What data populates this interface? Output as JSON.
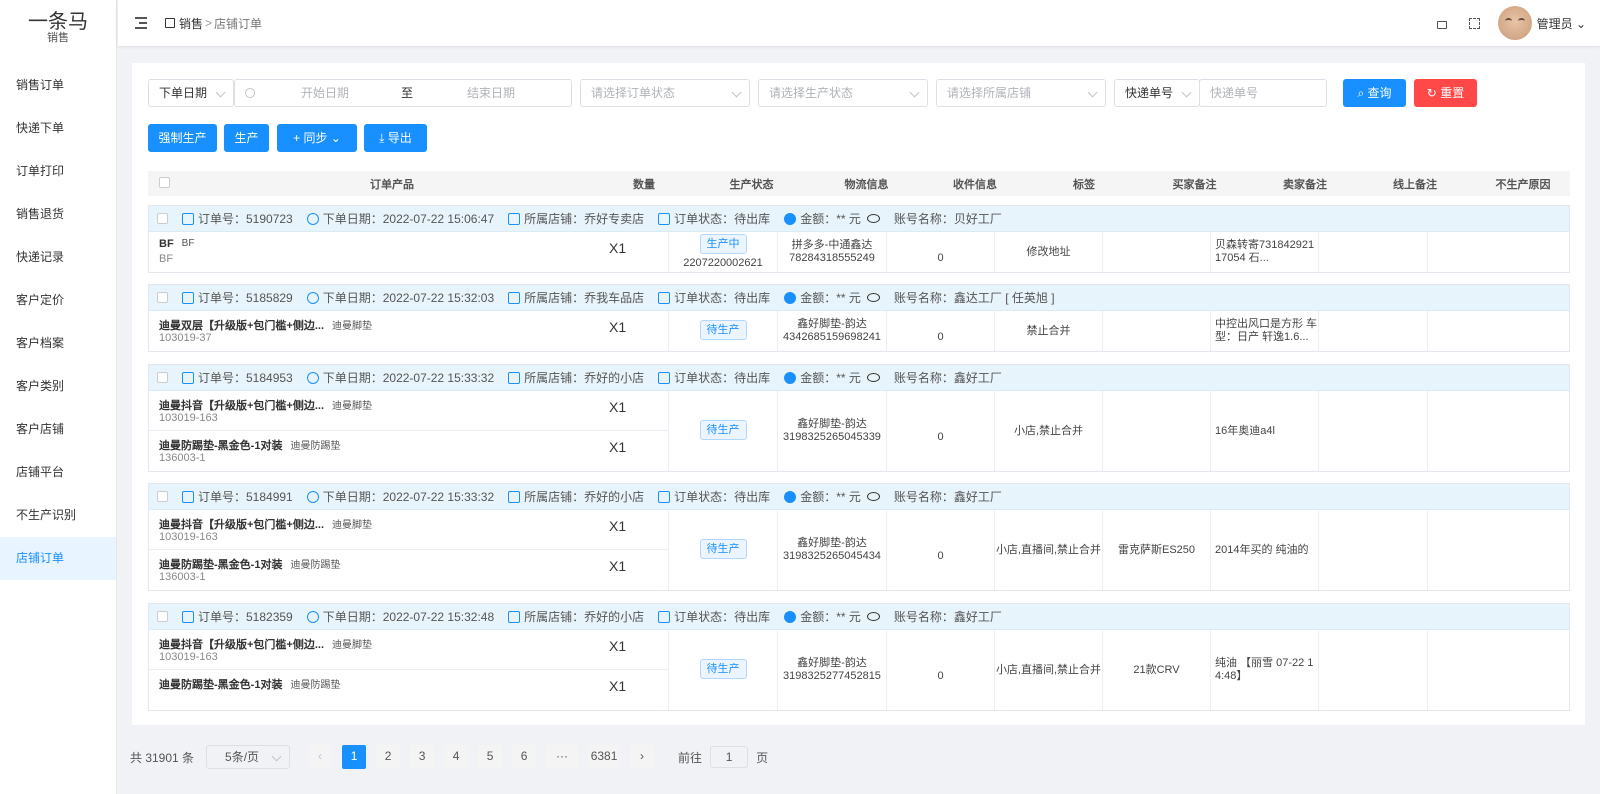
{
  "logo": {
    "title": "一条马",
    "subtitle": "销售"
  },
  "sidebar": {
    "items": [
      {
        "label": "销售订单"
      },
      {
        "label": "快递下单"
      },
      {
        "label": "订单打印"
      },
      {
        "label": "销售退货"
      },
      {
        "label": "快递记录"
      },
      {
        "label": "客户定价"
      },
      {
        "label": "客户档案"
      },
      {
        "label": "客户类别"
      },
      {
        "label": "客户店铺"
      },
      {
        "label": "店铺平台"
      },
      {
        "label": "不生产识别"
      },
      {
        "label": "店铺订单",
        "active": true
      }
    ]
  },
  "header": {
    "breadcrumb": {
      "home": "销售",
      "sep": ">",
      "current": "店铺订单"
    },
    "user": "管理员"
  },
  "filters": {
    "date_type": "下单日期",
    "start_placeholder": "开始日期",
    "range_sep": "至",
    "end_placeholder": "结束日期",
    "order_status_placeholder": "请选择订单状态",
    "production_status_placeholder": "请选择生产状态",
    "store_placeholder": "请选择所属店铺",
    "express_type": "快递单号",
    "express_placeholder": "快递单号",
    "search_label": "查询",
    "reset_label": "重置"
  },
  "actions": {
    "force_produce": "强制生产",
    "produce": "生产",
    "sync": "+ 同步 ⌄",
    "export": "⤓ 导出"
  },
  "table": {
    "columns": [
      "订单产品",
      "数量",
      "生产状态",
      "物流信息",
      "收件信息",
      "标签",
      "买家备注",
      "卖家备注",
      "线上备注",
      "不生产原因"
    ]
  },
  "orders": [
    {
      "order_no": "订单号：5190723",
      "date": "下单日期：2022-07-22 15:06:47",
      "store": "所属店铺：乔好专卖店",
      "status": "订单状态：待出库",
      "amount": "金额：** 元",
      "account": "账号名称：贝好工厂",
      "products": [
        {
          "name": "BF",
          "sub": "BF",
          "code": "BF",
          "qty": "X1"
        }
      ],
      "prod_status": "生产中",
      "prod_no": "2207220002621",
      "logistics": "拼多多-中通鑫达\n78284318555249",
      "recv": "0",
      "tag": "修改地址",
      "buyer_note": "",
      "seller_note": "贝森转寄731842921\n17054 石..."
    },
    {
      "order_no": "订单号：5185829",
      "date": "下单日期：2022-07-22 15:32:03",
      "store": "所属店铺：乔我车品店",
      "status": "订单状态：待出库",
      "amount": "金额：** 元",
      "account": "账号名称：鑫达工厂 [ 任英旭 ]",
      "products": [
        {
          "name": "迪曼双层【升级版+包门槛+侧边...",
          "sub": "迪曼脚垫",
          "code": "103019-37",
          "qty": "X1"
        }
      ],
      "prod_status": "待生产",
      "prod_no": "",
      "logistics": "鑫好脚垫-韵达\n4342685159698241",
      "recv": "0",
      "tag": "禁止合并",
      "buyer_note": "",
      "seller_note": "中控出风口是方形 车\n型：日产 轩逸1.6..."
    },
    {
      "order_no": "订单号：5184953",
      "date": "下单日期：2022-07-22 15:33:32",
      "store": "所属店铺：乔好的小店",
      "status": "订单状态：待出库",
      "amount": "金额：** 元",
      "account": "账号名称：鑫好工厂",
      "products": [
        {
          "name": "迪曼抖音【升级版+包门槛+侧边...",
          "sub": "迪曼脚垫",
          "code": "103019-163",
          "qty": "X1"
        },
        {
          "name": "迪曼防踢垫-黑金色-1对装",
          "sub": "迪曼防踢垫",
          "code": "136003-1",
          "qty": "X1"
        }
      ],
      "prod_status": "待生产",
      "prod_no": "",
      "logistics": "鑫好脚垫-韵达\n3198325265045339",
      "recv": "0",
      "tag": "小店,禁止合并",
      "buyer_note": "",
      "seller_note": "16年奥迪a4l"
    },
    {
      "order_no": "订单号：5184991",
      "date": "下单日期：2022-07-22 15:33:32",
      "store": "所属店铺：乔好的小店",
      "status": "订单状态：待出库",
      "amount": "金额：** 元",
      "account": "账号名称：鑫好工厂",
      "products": [
        {
          "name": "迪曼抖音【升级版+包门槛+侧边...",
          "sub": "迪曼脚垫",
          "code": "103019-163",
          "qty": "X1"
        },
        {
          "name": "迪曼防踢垫-黑金色-1对装",
          "sub": "迪曼防踢垫",
          "code": "136003-1",
          "qty": "X1"
        }
      ],
      "prod_status": "待生产",
      "prod_no": "",
      "logistics": "鑫好脚垫-韵达\n3198325265045434",
      "recv": "0",
      "tag": "小店,直播间,禁止合并",
      "buyer_note": "雷克萨斯ES250",
      "seller_note": "2014年买的 纯油的"
    },
    {
      "order_no": "订单号：5182359",
      "date": "下单日期：2022-07-22 15:32:48",
      "store": "所属店铺：乔好的小店",
      "status": "订单状态：待出库",
      "amount": "金额：** 元",
      "account": "账号名称：鑫好工厂",
      "products": [
        {
          "name": "迪曼抖音【升级版+包门槛+侧边...",
          "sub": "迪曼脚垫",
          "code": "103019-163",
          "qty": "X1"
        },
        {
          "name": "迪曼防踢垫-黑金色-1对装",
          "sub": "迪曼防踢垫",
          "code": "",
          "qty": "X1"
        }
      ],
      "prod_status": "待生产",
      "prod_no": "",
      "logistics": "鑫好脚垫-韵达\n3198325277452815",
      "recv": "0",
      "tag": "小店,直播间,禁止合并",
      "buyer_note": "21款CRV",
      "seller_note": "纯油 【丽雪 07-22 1\n4:48】"
    }
  ],
  "pagination": {
    "total": "共 31901 条",
    "page_size": "5条/页",
    "pages": [
      "1",
      "2",
      "3",
      "4",
      "5",
      "6",
      "···",
      "6381"
    ],
    "current": "1",
    "goto_label": "前往",
    "goto_value": "1",
    "page_unit": "页"
  },
  "colors": {
    "primary": "#1890ff",
    "danger": "#ff4949"
  }
}
